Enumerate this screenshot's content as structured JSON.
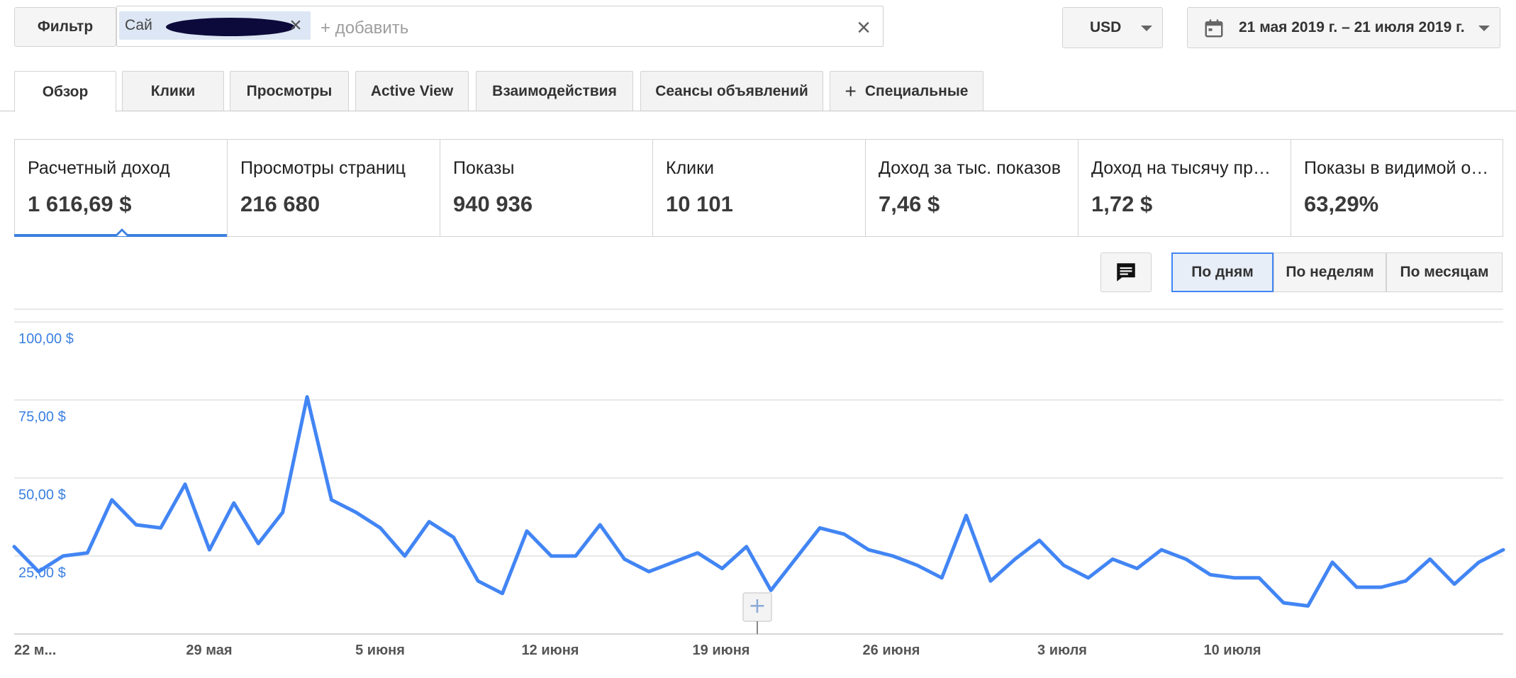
{
  "filter": {
    "button_label": "Фильтр",
    "chip_label": "Сай",
    "add_placeholder": "+ добавить"
  },
  "currency": {
    "selected": "USD"
  },
  "date_range": {
    "label": "21 мая 2019 г. – 21 июля 2019 г."
  },
  "tabs": [
    {
      "label": "Обзор"
    },
    {
      "label": "Клики"
    },
    {
      "label": "Просмотры"
    },
    {
      "label": "Active View"
    },
    {
      "label": "Взаимодействия"
    },
    {
      "label": "Сеансы объявлений"
    },
    {
      "label": "Специальные"
    }
  ],
  "kpis": [
    {
      "label": "Расчетный доход",
      "value": "1 616,69 $"
    },
    {
      "label": "Просмотры страниц",
      "value": "216 680"
    },
    {
      "label": "Показы",
      "value": "940 936"
    },
    {
      "label": "Клики",
      "value": "10 101"
    },
    {
      "label": "Доход за тыс. показов",
      "value": "7,46 $"
    },
    {
      "label": "Доход на тысячу просмотров",
      "value": "1,72 $"
    },
    {
      "label": "Показы в видимой области",
      "value": "63,29%"
    }
  ],
  "granularity": {
    "day": "По дням",
    "week": "По неделям",
    "month": "По месяцам"
  },
  "colors": {
    "accent": "#3b80e0",
    "series": "#4285f4"
  },
  "chart_data": {
    "type": "line",
    "title": "",
    "xlabel": "",
    "ylabel": "",
    "ylim": [
      0,
      100
    ],
    "y_ticks": [
      "25,00 $",
      "50,00 $",
      "75,00 $",
      "100,00 $"
    ],
    "x_ticks": [
      "22 м...",
      "29 мая",
      "5 июня",
      "12 июня",
      "19 июня",
      "26 июня",
      "3 июля",
      "10 июля"
    ],
    "grid": true,
    "legend": "none",
    "x": [
      "2019-05-21",
      "2019-05-22",
      "2019-05-23",
      "2019-05-24",
      "2019-05-25",
      "2019-05-26",
      "2019-05-27",
      "2019-05-28",
      "2019-05-29",
      "2019-05-30",
      "2019-05-31",
      "2019-06-01",
      "2019-06-02",
      "2019-06-03",
      "2019-06-04",
      "2019-06-05",
      "2019-06-06",
      "2019-06-07",
      "2019-06-08",
      "2019-06-09",
      "2019-06-10",
      "2019-06-11",
      "2019-06-12",
      "2019-06-13",
      "2019-06-14",
      "2019-06-15",
      "2019-06-16",
      "2019-06-17",
      "2019-06-18",
      "2019-06-19",
      "2019-06-20",
      "2019-06-21",
      "2019-06-22",
      "2019-06-23",
      "2019-06-24",
      "2019-06-25",
      "2019-06-26",
      "2019-06-27",
      "2019-06-28",
      "2019-06-29",
      "2019-06-30",
      "2019-07-01",
      "2019-07-02",
      "2019-07-03",
      "2019-07-04",
      "2019-07-05",
      "2019-07-06",
      "2019-07-07",
      "2019-07-08",
      "2019-07-09",
      "2019-07-10",
      "2019-07-11",
      "2019-07-12",
      "2019-07-13",
      "2019-07-14",
      "2019-07-15",
      "2019-07-16",
      "2019-07-17",
      "2019-07-18",
      "2019-07-19",
      "2019-07-20",
      "2019-07-21"
    ],
    "series": [
      {
        "values": [
          28,
          20,
          25,
          26,
          43,
          35,
          34,
          48,
          27,
          42,
          29,
          39,
          76,
          43,
          39,
          34,
          25,
          36,
          31,
          17,
          13,
          33,
          25,
          25,
          35,
          24,
          20,
          23,
          26,
          21,
          28,
          14,
          24,
          34,
          32,
          27,
          25,
          22,
          18,
          38,
          17,
          24,
          30,
          22,
          18,
          24,
          21,
          27,
          24,
          19,
          18,
          18,
          10,
          9,
          23,
          15,
          15,
          17,
          24,
          16,
          23,
          27
        ]
      }
    ]
  }
}
